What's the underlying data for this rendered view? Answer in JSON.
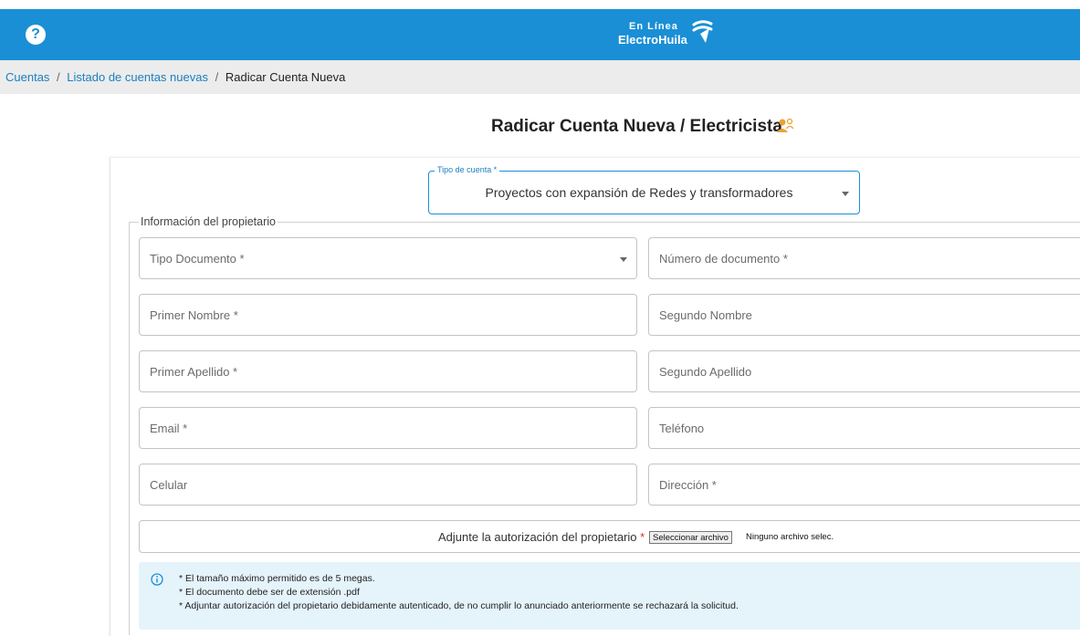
{
  "header": {
    "help_icon": "question-circle-icon",
    "help_glyph": "?",
    "logo_line1": "En Línea",
    "logo_line2": "ElectroHuila",
    "brand_color": "#1a8fd6"
  },
  "breadcrumb": {
    "items": [
      "Cuentas",
      "Listado de cuentas nuevas",
      "Radicar Cuenta Nueva"
    ],
    "separator": "/"
  },
  "page": {
    "title": "Radicar Cuenta Nueva / Electricista",
    "title_icon": "users-icon"
  },
  "tipo_cuenta": {
    "label": "Tipo de cuenta *",
    "value": "Proyectos con expansión de Redes y transformadores"
  },
  "owner_section": {
    "legend": "Información del propietario",
    "fields": {
      "tipo_documento": "Tipo Documento *",
      "numero_documento": "Número de documento *",
      "primer_nombre": "Primer Nombre *",
      "segundo_nombre": "Segundo Nombre",
      "primer_apellido": "Primer Apellido *",
      "segundo_apellido": "Segundo Apellido",
      "email": "Email *",
      "telefono": "Teléfono",
      "celular": "Celular",
      "direccion": "Dirección *"
    }
  },
  "upload": {
    "label": "Adjunte la autorización del propietario",
    "required_mark": "*",
    "button": "Seleccionar archivo",
    "status": "Ninguno archivo selec."
  },
  "info": {
    "icon": "info-circle-icon",
    "lines": [
      "* El tamaño máximo permitido es de 5 megas.",
      "* El documento debe ser de extensión .pdf",
      "* Adjuntar autorización del propietario debidamente autenticado, de no cumplir lo anunciado anteriormente se rechazará la solicitud."
    ]
  }
}
